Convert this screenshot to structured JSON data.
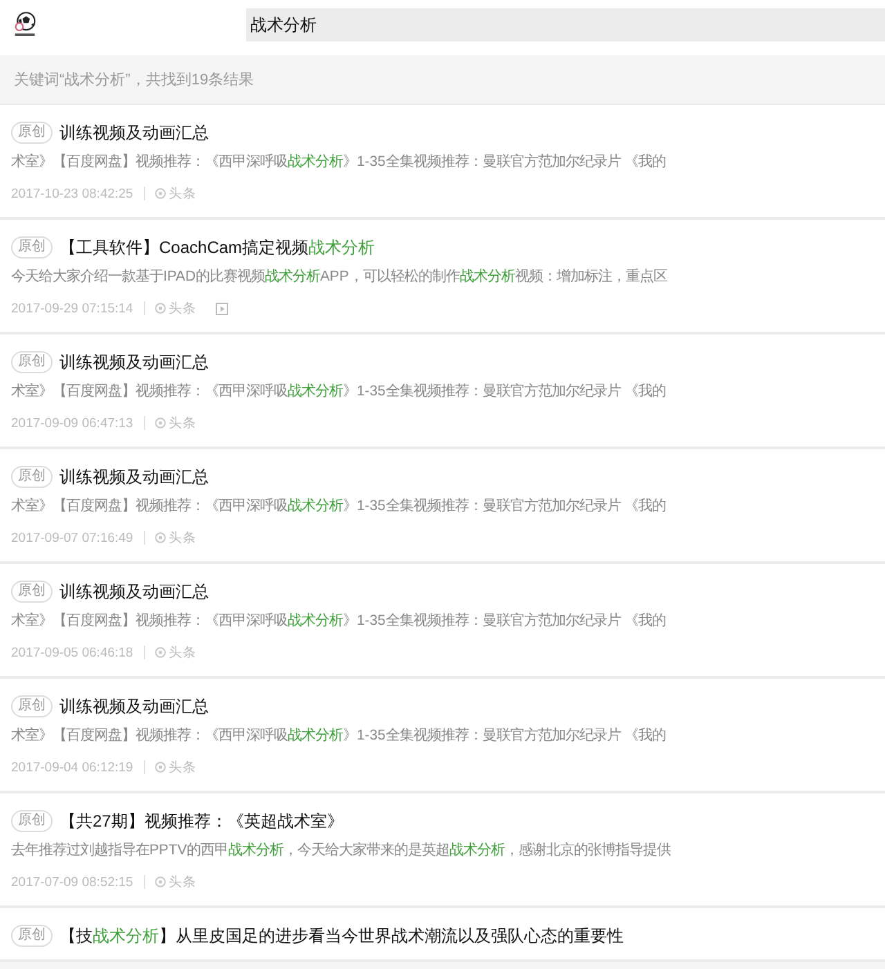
{
  "header": {
    "search": {
      "value": "战术分析"
    }
  },
  "summary": "关键词“战术分析”，共找到19条结果",
  "results": [
    {
      "badge": "原创",
      "title": [
        {
          "text": "训练视频及动画汇总",
          "highlight": false
        }
      ],
      "snippet": [
        {
          "text": "术室》【百度网盘】视频推荐：《西甲深呼吸",
          "highlight": false
        },
        {
          "text": "战术分析",
          "highlight": true
        },
        {
          "text": "》1-35全集视频推荐：曼联官方范加尔纪录片 《我的",
          "highlight": false
        }
      ],
      "date": "2017-10-23 08:42:25",
      "source": "头条",
      "video": false
    },
    {
      "badge": "原创",
      "title": [
        {
          "text": "【工具软件】CoachCam搞定视频",
          "highlight": false
        },
        {
          "text": "战术分析",
          "highlight": true
        }
      ],
      "snippet": [
        {
          "text": "今天给大家介绍一款基于IPAD的比赛视频",
          "highlight": false
        },
        {
          "text": "战术分析",
          "highlight": true
        },
        {
          "text": "APP，可以轻松的制作",
          "highlight": false
        },
        {
          "text": "战术分析",
          "highlight": true
        },
        {
          "text": "视频：增加标注，重点区",
          "highlight": false
        }
      ],
      "date": "2017-09-29 07:15:14",
      "source": "头条",
      "video": true
    },
    {
      "badge": "原创",
      "title": [
        {
          "text": "训练视频及动画汇总",
          "highlight": false
        }
      ],
      "snippet": [
        {
          "text": "术室》【百度网盘】视频推荐：《西甲深呼吸",
          "highlight": false
        },
        {
          "text": "战术分析",
          "highlight": true
        },
        {
          "text": "》1-35全集视频推荐：曼联官方范加尔纪录片 《我的",
          "highlight": false
        }
      ],
      "date": "2017-09-09 06:47:13",
      "source": "头条",
      "video": false
    },
    {
      "badge": "原创",
      "title": [
        {
          "text": "训练视频及动画汇总",
          "highlight": false
        }
      ],
      "snippet": [
        {
          "text": "术室》【百度网盘】视频推荐：《西甲深呼吸",
          "highlight": false
        },
        {
          "text": "战术分析",
          "highlight": true
        },
        {
          "text": "》1-35全集视频推荐：曼联官方范加尔纪录片 《我的",
          "highlight": false
        }
      ],
      "date": "2017-09-07 07:16:49",
      "source": "头条",
      "video": false
    },
    {
      "badge": "原创",
      "title": [
        {
          "text": "训练视频及动画汇总",
          "highlight": false
        }
      ],
      "snippet": [
        {
          "text": "术室》【百度网盘】视频推荐：《西甲深呼吸",
          "highlight": false
        },
        {
          "text": "战术分析",
          "highlight": true
        },
        {
          "text": "》1-35全集视频推荐：曼联官方范加尔纪录片 《我的",
          "highlight": false
        }
      ],
      "date": "2017-09-05 06:46:18",
      "source": "头条",
      "video": false
    },
    {
      "badge": "原创",
      "title": [
        {
          "text": "训练视频及动画汇总",
          "highlight": false
        }
      ],
      "snippet": [
        {
          "text": "术室》【百度网盘】视频推荐：《西甲深呼吸",
          "highlight": false
        },
        {
          "text": "战术分析",
          "highlight": true
        },
        {
          "text": "》1-35全集视频推荐：曼联官方范加尔纪录片 《我的",
          "highlight": false
        }
      ],
      "date": "2017-09-04 06:12:19",
      "source": "头条",
      "video": false
    },
    {
      "badge": "原创",
      "title": [
        {
          "text": "【共27期】视频推荐：《英超战术室》",
          "highlight": false
        }
      ],
      "snippet": [
        {
          "text": "去年推荐过刘越指导在PPTV的西甲",
          "highlight": false
        },
        {
          "text": "战术分析",
          "highlight": true
        },
        {
          "text": "，今天给大家带来的是英超",
          "highlight": false
        },
        {
          "text": "战术分析",
          "highlight": true
        },
        {
          "text": "，感谢北京的张博指导提供",
          "highlight": false
        }
      ],
      "date": "2017-07-09 08:52:15",
      "source": "头条",
      "video": false
    },
    {
      "badge": "原创",
      "title": [
        {
          "text": "【技",
          "highlight": false
        },
        {
          "text": "战术分析",
          "highlight": true
        },
        {
          "text": "】从里皮国足的进步看当今世界战术潮流以及强队心态的重要性",
          "highlight": false
        }
      ]
    }
  ]
}
